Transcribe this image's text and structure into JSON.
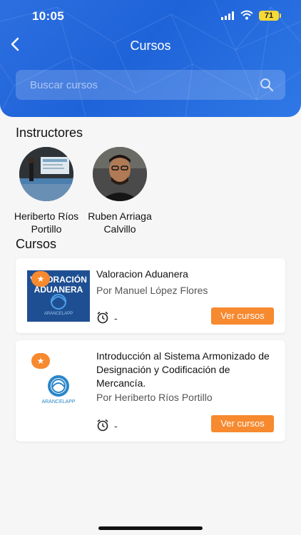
{
  "status_bar": {
    "time": "10:05",
    "battery": "71"
  },
  "header": {
    "title": "Cursos",
    "back_icon": "chevron-left-icon"
  },
  "search": {
    "placeholder": "Buscar cursos",
    "value": ""
  },
  "instructors_section": {
    "title": "Instructores",
    "items": [
      {
        "name": "Heriberto Ríos Portillo"
      },
      {
        "name": "Ruben Arriaga Calvillo"
      }
    ]
  },
  "courses_section": {
    "title": "Cursos",
    "items": [
      {
        "thumb_text": "VALORACIÓN ADUANERA",
        "thumb_brand": "ARANCELAPP",
        "title": "Valoracion Aduanera",
        "author": "Por Manuel López Flores",
        "duration": "-",
        "button": "Ver cursos",
        "featured": true
      },
      {
        "thumb_brand": "ARANCELAPP",
        "title": "Introducción al Sistema Armonizado de Designación y Codificación de Mercancía.",
        "author": "Por Heriberto Ríos Portillo",
        "duration": "-",
        "button": "Ver cursos",
        "featured": true
      }
    ]
  },
  "colors": {
    "header_blue": "#1f63d9",
    "accent_orange": "#f7892f",
    "background": "#f6f6f6"
  }
}
